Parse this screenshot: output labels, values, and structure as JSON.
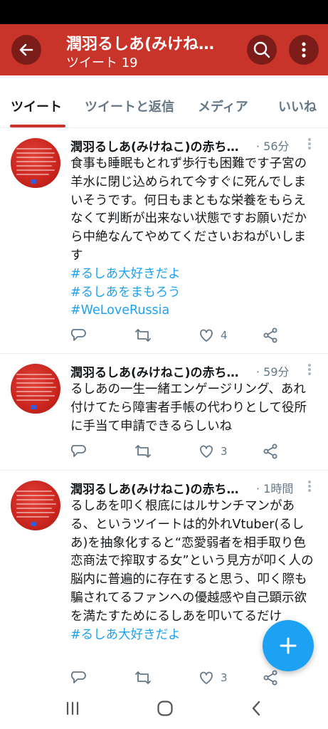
{
  "header": {
    "title": "潤羽るしあ(みけね…",
    "subtitle": "ツイート 19"
  },
  "tabs": [
    {
      "label": "ツイート"
    },
    {
      "label": "ツイートと返信"
    },
    {
      "label": "メディア"
    },
    {
      "label": "いいね"
    }
  ],
  "tweets": [
    {
      "name": "潤羽るしあ(みけねこ)の赤ち…",
      "time": "· 56分",
      "text": "食事も睡眠もとれず歩行も困難です子宮の羊水に閉じ込められて今すぐに死んでしまいそうです。何日もまともな栄養をもらえなくて判断が出来ない状態ですお願いだから中絶なんてやめてくださいおねがいします",
      "hashtags": [
        "#るしあ大好きだよ",
        "#るしあをまもろう",
        "#WeLoveRussia"
      ],
      "likes": "4"
    },
    {
      "name": "潤羽るしあ(みけねこ)の赤ち…",
      "time": "· 59分",
      "text": "るしあの一生一緒エンゲージリング、あれ付けてたら障害者手帳の代わりとして役所に手当て申請できるらしいね",
      "hashtags": [],
      "likes": "3"
    },
    {
      "name": "潤羽るしあ(みけねこ)の赤ち…",
      "time": "· 1時間",
      "text": "るしあを叩く根底にはルサンチマンがある、というツイートは的外れVtuber(るしあ)を抽象化すると“恋愛弱者を相手取り色恋商法で搾取する女”という見方が叩く人の脳内に普遍的に存在すると思う、叩く際も騙されてるファンへの優越感や自己顕示欲を満たすためにるしあを叩いてるだけ",
      "hashtags": [
        "#るしあ大好きだよ"
      ],
      "likes": "3"
    }
  ],
  "colors": {
    "header_bg": "#c8342a",
    "accent_blue": "#1da1f2",
    "muted_gray": "#657786"
  },
  "icons": {
    "back": "arrow-left-icon",
    "search": "search-icon",
    "more": "more-vertical-icon",
    "reply": "reply-icon",
    "retweet": "retweet-icon",
    "like": "heart-icon",
    "share": "share-icon",
    "compose": "plus-icon"
  }
}
